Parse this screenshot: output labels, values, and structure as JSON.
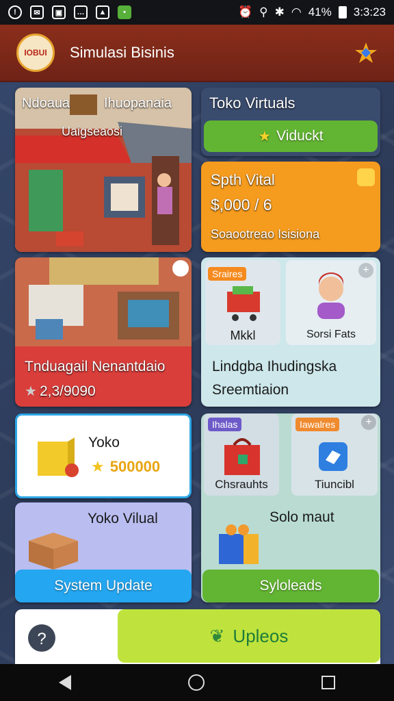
{
  "status": {
    "time": "3:3:23",
    "battery": "41%",
    "left_icons": [
      "info-icon",
      "mail-icon",
      "lock-icon",
      "message-icon",
      "image-icon",
      "chat-icon"
    ]
  },
  "header": {
    "title": "Simulasi Bisinis",
    "logo_text": "IOBUI"
  },
  "cards": {
    "store1": {
      "title_left": "Ndoaua",
      "title_right": "Ihuopanaia",
      "sub": "Uaigseaosi"
    },
    "virtual": {
      "title": "Toko Virtuals",
      "button": "Viduckt"
    },
    "sales": {
      "title": "Spth Vital",
      "amount": "$,000 / 6",
      "sub": "Soaootreao Isisiona"
    },
    "store2": {
      "title": "Tnduagail Nenantdaio",
      "amount": "2,3/9090"
    },
    "market": {
      "tag": "Sraires",
      "item1": "Mkkl",
      "item2": "Sorsi Fats",
      "title": "Lindgba Ihudingska",
      "sub": "Sreemtiaion"
    },
    "toko": {
      "title": "Yoko",
      "amount": "500000"
    },
    "yoko2": {
      "title": "Yoko Vilual"
    },
    "items": {
      "tag1": "Ihalas",
      "label1": "Chsrauhts",
      "tag2": "Iawalres",
      "label2": "Tiuncibl"
    },
    "solo": {
      "title": "Solo maut"
    }
  },
  "buttons": {
    "system": "System Update",
    "side": "Syloleads",
    "upgrade": "Upleos"
  },
  "colors": {
    "header": "#7b2818",
    "green": "#62b532",
    "orange": "#f59b1e",
    "blue": "#24a6f0",
    "red": "#d93e3a",
    "lime": "#bfe33c"
  }
}
